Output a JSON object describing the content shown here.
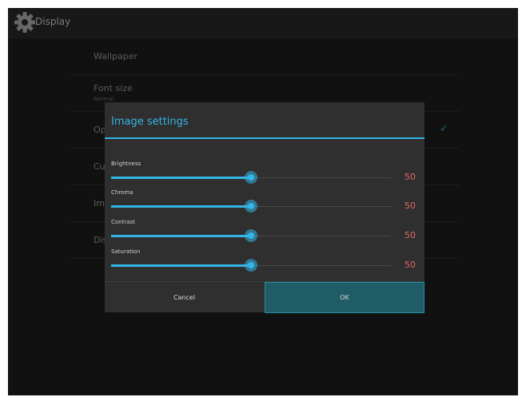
{
  "actionbar": {
    "title": "Display",
    "icon": "settings-gear-icon"
  },
  "list": {
    "items": [
      {
        "title": "Wallpaper",
        "summary": ""
      },
      {
        "title": "Font size",
        "summary": "Normal"
      },
      {
        "title": "Opt",
        "summary": "",
        "checked": true
      },
      {
        "title": "Cus",
        "summary": ""
      },
      {
        "title": "Ima",
        "summary": ""
      },
      {
        "title": "Dis",
        "summary": ""
      }
    ]
  },
  "dialog": {
    "title": "Image settings",
    "settings": [
      {
        "label": "Brightness",
        "value": "50",
        "level": 50
      },
      {
        "label": "Chroma",
        "value": "50",
        "level": 50
      },
      {
        "label": "Contrast",
        "value": "50",
        "level": 50
      },
      {
        "label": "Saturation",
        "value": "50",
        "level": 50
      }
    ],
    "buttons": {
      "cancel": "Cancel",
      "ok": "OK"
    }
  },
  "colors": {
    "accent": "#33b5e5",
    "value_text": "#e06a5f",
    "ok_button_bg": "#1f5c65",
    "background": "#1b1b1b"
  }
}
